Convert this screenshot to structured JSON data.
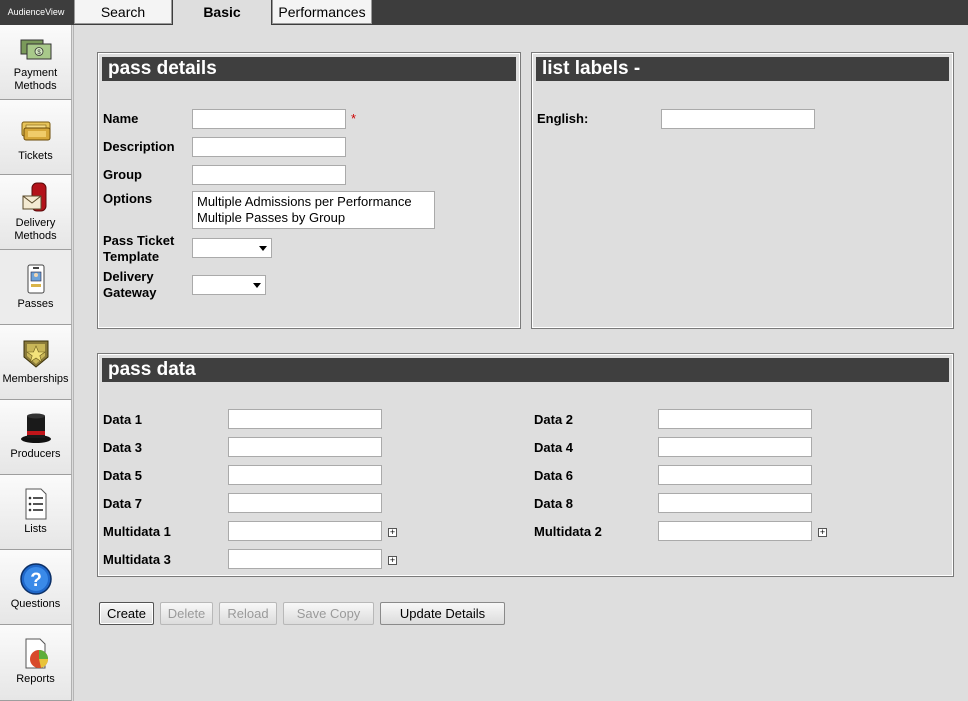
{
  "app": {
    "title": "AudienceView"
  },
  "tabs": [
    {
      "label": "Search"
    },
    {
      "label": "Basic"
    },
    {
      "label": "Performances"
    }
  ],
  "sidebar": {
    "items": [
      {
        "label1": "Payment",
        "label2": "Methods",
        "icon": "payment-methods-icon"
      },
      {
        "label1": "Tickets",
        "label2": "",
        "icon": "tickets-icon"
      },
      {
        "label1": "Delivery",
        "label2": "Methods",
        "icon": "delivery-methods-icon"
      },
      {
        "label1": "Passes",
        "label2": "",
        "icon": "passes-icon"
      },
      {
        "label1": "Memberships",
        "label2": "",
        "icon": "memberships-icon"
      },
      {
        "label1": "Producers",
        "label2": "",
        "icon": "producers-icon"
      },
      {
        "label1": "Lists",
        "label2": "",
        "icon": "lists-icon"
      },
      {
        "label1": "Questions",
        "label2": "",
        "icon": "questions-icon"
      },
      {
        "label1": "Reports",
        "label2": "",
        "icon": "reports-icon"
      }
    ]
  },
  "pass_details": {
    "title": "pass details",
    "name_label": "Name",
    "name_value": "",
    "required_mark": "*",
    "description_label": "Description",
    "description_value": "",
    "group_label": "Group",
    "group_value": "",
    "options_label": "Options",
    "options": [
      "Multiple Admissions per Performance",
      "Multiple Passes by Group"
    ],
    "ticket_template_label1": "Pass Ticket",
    "ticket_template_label2": "Template",
    "ticket_template_value": "",
    "delivery_gateway_label1": "Delivery",
    "delivery_gateway_label2": "Gateway",
    "delivery_gateway_value": ""
  },
  "list_labels": {
    "title": "list labels -",
    "english_label": "English:",
    "english_value": ""
  },
  "pass_data": {
    "title": "pass data",
    "data1_label": "Data 1",
    "data2_label": "Data 2",
    "data3_label": "Data 3",
    "data4_label": "Data 4",
    "data5_label": "Data 5",
    "data6_label": "Data 6",
    "data7_label": "Data 7",
    "data8_label": "Data 8",
    "multidata1_label": "Multidata 1",
    "multidata2_label": "Multidata 2",
    "multidata3_label": "Multidata 3",
    "expand_symbol": "+"
  },
  "buttons": {
    "create": "Create",
    "delete": "Delete",
    "reload": "Reload",
    "save_copy": "Save Copy",
    "update_details": "Update Details"
  }
}
